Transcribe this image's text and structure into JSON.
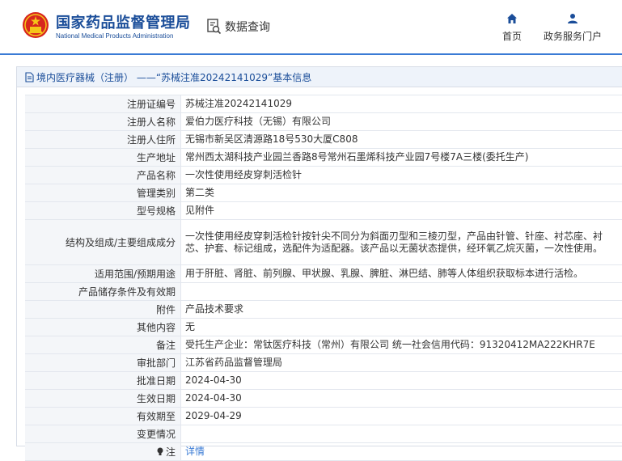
{
  "header": {
    "brand_cn": "国家药品监督管理局",
    "brand_en": "National Medical Products Administration",
    "search_label": "数据查询",
    "nav": [
      {
        "label": "首页",
        "icon": "home-icon"
      },
      {
        "label": "政务服务门户",
        "icon": "user-icon"
      }
    ]
  },
  "colors": {
    "brand": "#1a4d99",
    "accent": "#3a7bd5",
    "emblem_red": "#d7261e",
    "emblem_gold": "#f5c518"
  },
  "panel": {
    "title": "境内医疗器械（注册） ——“苏械注准20242141029”基本信息"
  },
  "rows": [
    {
      "key": "注册证编号",
      "value": "苏械注准20242141029"
    },
    {
      "key": "注册人名称",
      "value": "爱伯力医疗科技（无锡）有限公司"
    },
    {
      "key": "注册人住所",
      "value": "无锡市新吴区清源路18号530大厦C808"
    },
    {
      "key": "生产地址",
      "value": "常州西太湖科技产业园兰香路8号常州石墨烯科技产业园7号楼7A三楼(委托生产)"
    },
    {
      "key": "产品名称",
      "value": "一次性使用经皮穿刺活检针"
    },
    {
      "key": "管理类别",
      "value": "第二类"
    },
    {
      "key": "型号规格",
      "value": "见附件"
    },
    {
      "key": "结构及组成/主要组成成分",
      "value": "一次性使用经皮穿刺活检针按针尖不同分为斜面刃型和三棱刃型，产品由针管、针座、衬芯座、衬芯、护套、标记组成，选配件为适配器。该产品以无菌状态提供，经环氧乙烷灭菌，一次性使用。"
    },
    {
      "key": "适用范围/预期用途",
      "value": "用于肝脏、肾脏、前列腺、甲状腺、乳腺、脾脏、淋巴结、肺等人体组织获取标本进行活检。"
    },
    {
      "key": "产品储存条件及有效期",
      "value": ""
    },
    {
      "key": "附件",
      "value": "产品技术要求"
    },
    {
      "key": "其他内容",
      "value": "无"
    },
    {
      "key": "备注",
      "value": "受托生产企业：常钛医疗科技（常州）有限公司 统一社会信用代码：91320412MA222KHR7E"
    },
    {
      "key": "审批部门",
      "value": "江苏省药品监督管理局"
    },
    {
      "key": "批准日期",
      "value": "2024-04-30"
    },
    {
      "key": "生效日期",
      "value": "2024-04-30"
    },
    {
      "key": "有效期至",
      "value": "2029-04-29"
    },
    {
      "key": "变更情况",
      "value": ""
    }
  ],
  "note_row": {
    "key": "注",
    "link": "详情"
  }
}
